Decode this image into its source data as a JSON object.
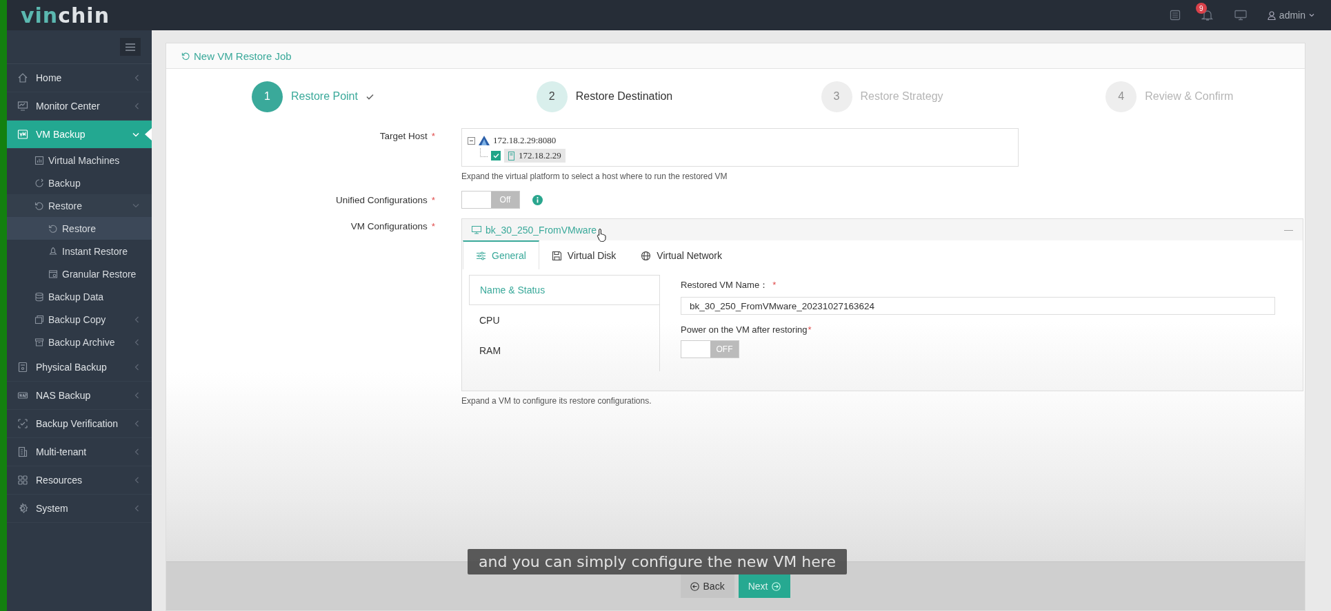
{
  "topbar": {
    "logo": {
      "first": "vin",
      "second": "chin"
    },
    "notification_count": "9",
    "user": "admin"
  },
  "sidebar": {
    "items": [
      {
        "label": "Home",
        "expanded": false,
        "selected": false
      },
      {
        "label": "Monitor Center",
        "expanded": false,
        "selected": false
      },
      {
        "label": "VM Backup",
        "expanded": true,
        "selected": true,
        "children": [
          {
            "label": "Virtual Machines",
            "selected": false
          },
          {
            "label": "Backup",
            "selected": false
          },
          {
            "label": "Restore",
            "expanded": true,
            "selected": false,
            "children": [
              {
                "label": "Restore",
                "selected": true
              },
              {
                "label": "Instant Restore",
                "selected": false
              },
              {
                "label": "Granular Restore",
                "selected": false
              }
            ]
          },
          {
            "label": "Backup Data",
            "selected": false
          },
          {
            "label": "Backup Copy",
            "expanded": false,
            "selected": false
          },
          {
            "label": "Backup Archive",
            "expanded": false,
            "selected": false
          }
        ]
      },
      {
        "label": "Physical Backup",
        "expanded": false,
        "selected": false
      },
      {
        "label": "NAS Backup",
        "expanded": false,
        "selected": false
      },
      {
        "label": "Backup Verification",
        "expanded": false,
        "selected": false
      },
      {
        "label": "Multi-tenant",
        "expanded": false,
        "selected": false
      },
      {
        "label": "Resources",
        "expanded": false,
        "selected": false
      },
      {
        "label": "System",
        "expanded": false,
        "selected": false
      }
    ]
  },
  "job": {
    "title": "New VM Restore Job",
    "steps": [
      {
        "number": "1",
        "label": "Restore Point",
        "done": true,
        "current": false
      },
      {
        "number": "2",
        "label": "Restore Destination",
        "done": false,
        "current": true
      },
      {
        "number": "3",
        "label": "Restore Strategy",
        "done": false,
        "current": false
      },
      {
        "number": "4",
        "label": "Review & Confirm",
        "done": false,
        "current": false
      }
    ]
  },
  "target_host": {
    "label": "Target Host",
    "required_mark": "*",
    "tree": {
      "label": "172.18.2.29:8080",
      "expanded": true,
      "children": [
        {
          "label": "172.18.2.29",
          "checked": true,
          "selected": true
        }
      ]
    },
    "hint": "Expand the virtual platform to select a host where to run the restored VM"
  },
  "unified_configurations": {
    "label": "Unified Configurations",
    "required_mark": "*",
    "toggle": {
      "on": false,
      "text": "Off"
    }
  },
  "vm_configurations": {
    "label": "VM Configurations",
    "required_mark": "*",
    "vm_name": "bk_30_250_FromVMware",
    "collapse": "—",
    "tabs": [
      {
        "label": "General",
        "selected": true
      },
      {
        "label": "Virtual Disk",
        "selected": false
      },
      {
        "label": "Virtual Network",
        "selected": false
      }
    ],
    "menu": [
      {
        "label": "Name & Status",
        "selected": true
      },
      {
        "label": "CPU",
        "selected": false
      },
      {
        "label": "RAM",
        "selected": false
      }
    ],
    "name_label": "Restored VM Name：",
    "name_required_mark": "*",
    "name_value": "bk_30_250_FromVMware_20231027163624",
    "power_label": "Power on the VM after restoring",
    "power_required_mark": "*",
    "power_toggle": {
      "on": false,
      "text": "OFF"
    },
    "hint": "Expand a VM to configure its restore configurations."
  },
  "buttons": {
    "back": "Back",
    "next": "Next"
  },
  "caption": "and you can simply configure the new VM here"
}
